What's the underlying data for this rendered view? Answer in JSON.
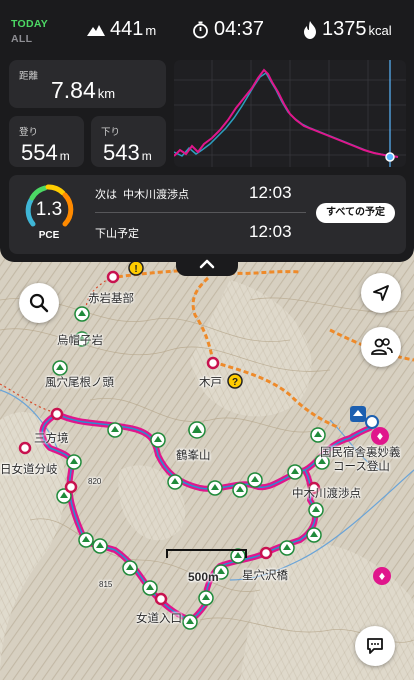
{
  "header": {
    "today_label": "TODAY",
    "all_label": "ALL",
    "climb_value": "441",
    "climb_unit": "m",
    "time_value": "04:37",
    "calories_value": "1375",
    "calories_unit": "kcal"
  },
  "cards": {
    "distance_label": "距離",
    "distance_value": "7.84",
    "distance_unit": "km",
    "ascent_label": "登り",
    "ascent_value": "554",
    "ascent_unit": "m",
    "descent_label": "下り",
    "descent_value": "543",
    "descent_unit": "m"
  },
  "pace": {
    "value": "1.3",
    "label": "PCE"
  },
  "plan": {
    "next_label": "次は",
    "next_place": "中木川渡渉点",
    "next_time": "12:03",
    "descent_label": "下山予定",
    "descent_time": "12:03",
    "schedule_button": "すべての予定"
  },
  "map": {
    "labels": {
      "akaiwa": "赤岩基部",
      "eboshi": "烏帽子岩",
      "fuketsu": "風穴尾根ノ頭",
      "sanpou": "三方境",
      "medo_bunki": "日女道分岐",
      "kido": "木戸",
      "tsurumine": "鶴峯山",
      "kokumin": "国民宿舎裏妙義",
      "kokumin2": "コース登山",
      "nakagi": "中木川渡渉点",
      "hoshiana": "星穴沢橋",
      "medo_iriguchi": "女道入口",
      "scale": "500m",
      "contour_820": "820",
      "contour_815": "815"
    }
  },
  "colors": {
    "accent_green": "#4cd964",
    "track_magenta": "#e0168c",
    "track_blue": "#2a8fd0",
    "route_orange": "#f08a24",
    "panel_bg": "#1b1b1d"
  },
  "icons": {
    "climb": "mountain-icon",
    "time": "stopwatch-icon",
    "calories": "flame-icon",
    "search": "search-icon",
    "locate": "location-arrow-icon",
    "people": "people-icon",
    "chat": "chat-bubble-icon",
    "collapse": "chevron-up-icon"
  }
}
